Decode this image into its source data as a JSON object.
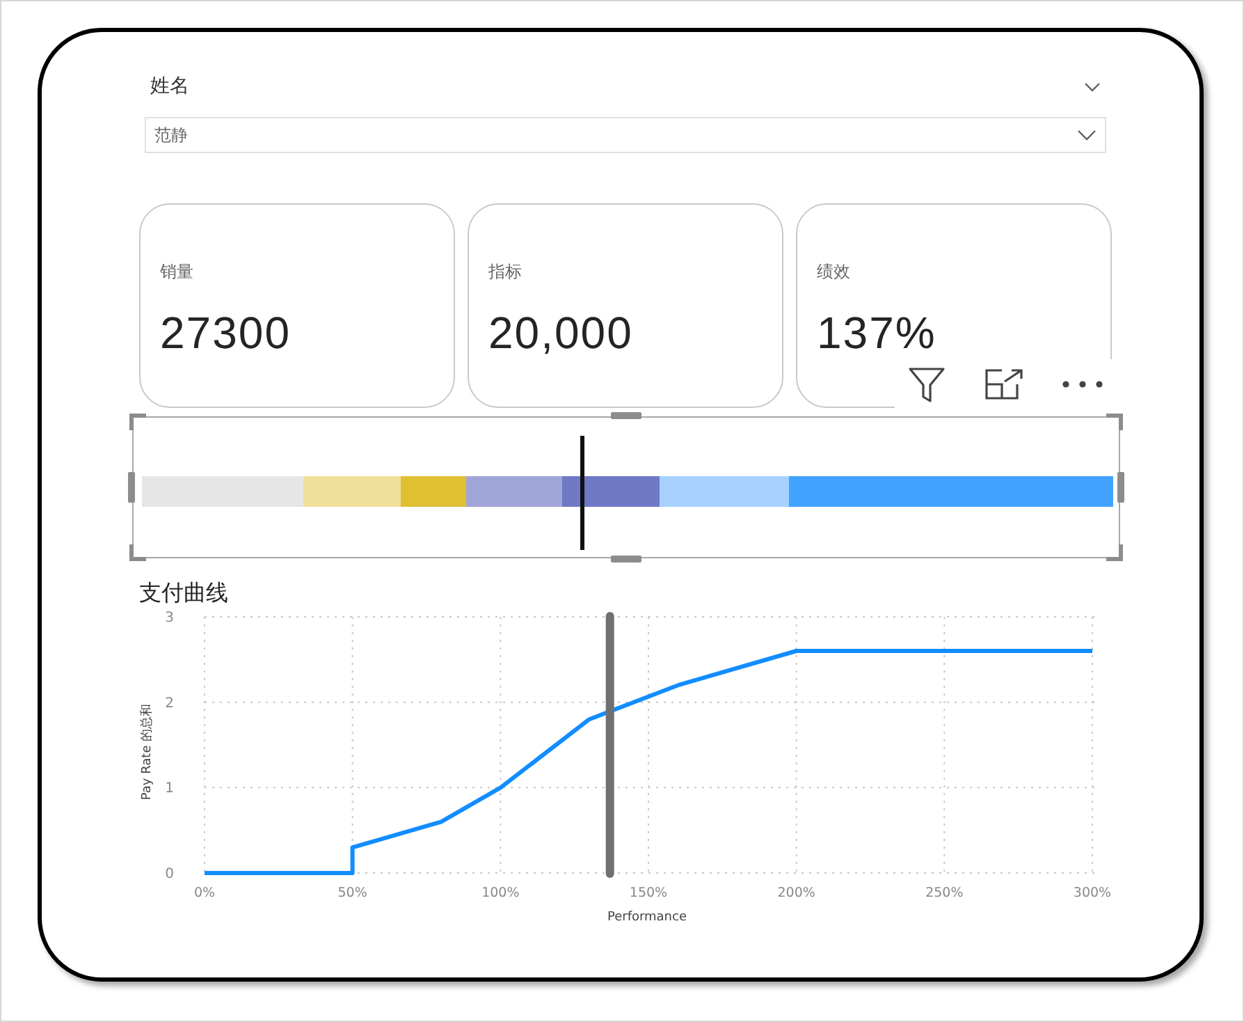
{
  "slicer": {
    "title": "姓名",
    "value": "范静"
  },
  "kpi_cards": [
    {
      "label": "销量",
      "value": "27300"
    },
    {
      "label": "指标",
      "value": "20,000"
    },
    {
      "label": "绩效",
      "value": "137%"
    }
  ],
  "bullet_chart": {
    "selected": true,
    "level": 0.453,
    "bands": [
      {
        "color": "#e6e6e6"
      },
      {
        "color": "#f1e09b"
      },
      {
        "color": "#e0c032"
      },
      {
        "color": "#a1a6d9"
      },
      {
        "color": "#6f79c6"
      },
      {
        "color": "#a6d1ff"
      },
      {
        "color": "#41a3ff"
      }
    ]
  },
  "pay_chart": {
    "chart_data": {
      "type": "line",
      "title": "支付曲线",
      "xlabel": "Performance",
      "ylabel": "Pay Rate 的总和",
      "x": [
        0,
        50,
        50,
        80,
        100,
        130,
        160,
        200,
        300
      ],
      "series": [
        {
          "color": "#118dff",
          "values": [
            0,
            0,
            0.3,
            0.6,
            1,
            1.8,
            2.2,
            2.6,
            2.6
          ]
        }
      ],
      "xlim": [
        0,
        300
      ],
      "ylim": [
        0,
        3
      ],
      "xticks": [
        {
          "value": 0,
          "label": "0%"
        },
        {
          "value": 50,
          "label": "50%"
        },
        {
          "value": 100,
          "label": "100%"
        },
        {
          "value": 150,
          "label": "150%"
        },
        {
          "value": 200,
          "label": "200%"
        },
        {
          "value": 250,
          "label": "250%"
        },
        {
          "value": 300,
          "label": "300%"
        }
      ],
      "yticks": [
        0,
        1,
        2,
        3
      ],
      "grid": true,
      "ref_lines": [
        {
          "axis": "x",
          "value": 137
        }
      ]
    }
  }
}
